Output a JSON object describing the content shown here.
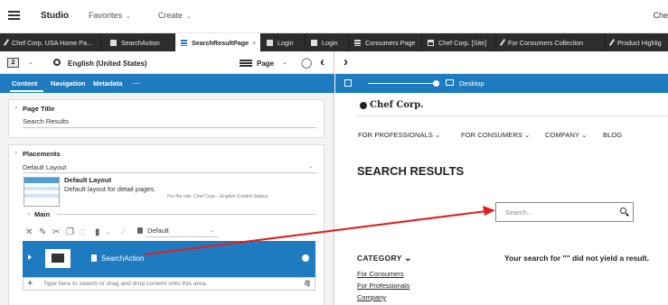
{
  "app": {
    "brand": "Studio",
    "menu": [
      {
        "label": "Favorites"
      },
      {
        "label": "Create"
      }
    ],
    "top_right": "Che"
  },
  "tabs": [
    {
      "label": "Chef Corp. USA Home Pa...",
      "icon": "pencil-icon"
    },
    {
      "label": "SearchAction",
      "icon": "document-icon"
    },
    {
      "label": "SearchResultPage",
      "icon": "page-list-icon",
      "active": true
    },
    {
      "label": "Login",
      "icon": "document-icon"
    },
    {
      "label": "Login",
      "icon": "document-icon"
    },
    {
      "label": "Consumers Page",
      "icon": "page-list-icon"
    },
    {
      "label": "Chef Corp. [Site]",
      "icon": "site-icon"
    },
    {
      "label": "For Consumers Collection",
      "icon": "pencil-icon"
    },
    {
      "label": "Product Highlig",
      "icon": "pencil-icon"
    }
  ],
  "toolbar": {
    "locale": "English (United States)",
    "view_mode": "Page"
  },
  "editor_tabs": {
    "items": [
      {
        "label": "Content"
      },
      {
        "label": "Navigation"
      },
      {
        "label": "Metadata"
      },
      {
        "label": "···"
      }
    ]
  },
  "preview_bar": {
    "device": "Desktop"
  },
  "page_title_section": {
    "title": "Page Title",
    "value": "Search Results"
  },
  "placements_section": {
    "title": "Placements",
    "layout_select": "Default Layout",
    "layout_name": "Default Layout",
    "layout_desc": "Default layout for detail pages.",
    "layout_site": "For the site: Chef Corp. - English (United States)",
    "main_label": "Main",
    "visibility_select": "Default",
    "placed_item": "SearchAction",
    "dropzone_text": "Type here to search or drag and drop content onto this area."
  },
  "preview": {
    "logo": "Chef Corp.",
    "nav": [
      {
        "label": "FOR PROFESSIONALS",
        "dropdown": true
      },
      {
        "label": "FOR CONSUMERS",
        "dropdown": true
      },
      {
        "label": "COMPANY",
        "dropdown": true
      },
      {
        "label": "BLOG",
        "dropdown": false
      }
    ],
    "heading": "SEARCH RESULTS",
    "search_placeholder": "Search...",
    "category_label": "CATEGORY",
    "no_result": "Your search for \"\" did not yield a result.",
    "category_links": [
      "For Consumers",
      "For Professionals",
      "Company"
    ]
  },
  "colors": {
    "accent": "#1e7bbf",
    "tabbar": "#2d2d2d",
    "annotation_arrow": "#e02020"
  }
}
